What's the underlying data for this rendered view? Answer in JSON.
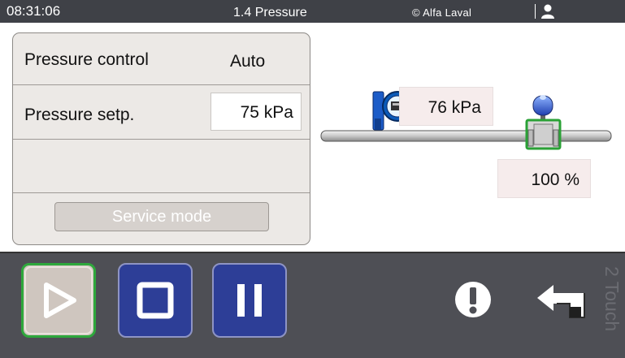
{
  "header": {
    "time": "08:31:06",
    "title": "1.4 Pressure",
    "brand": "© Alfa Laval",
    "user_icon": "user-icon"
  },
  "panel": {
    "rows": [
      {
        "label": "Pressure control",
        "value": "Auto"
      },
      {
        "label": "Pressure setp.",
        "value": "75 kPa"
      }
    ],
    "service_button": "Service mode"
  },
  "diagram": {
    "pressure_reading": "76 kPa",
    "valve_position": "100 %",
    "transmitter_icon": "pressure-transmitter-icon",
    "valve_icon": "control-valve-icon"
  },
  "commands": {
    "start_icon": "play-icon",
    "stop_icon": "stop-icon",
    "pause_icon": "pause-icon",
    "alarm_icon": "alarm-icon",
    "back_icon": "back-arrow-icon",
    "vertical_brand": "2 Touch"
  },
  "colors": {
    "header_bg": "#3f4147",
    "panel_bg": "#ece9e6",
    "command_bar_bg": "#4e4f55",
    "button_blue": "#2d3e97",
    "active_green": "#2ea83c"
  }
}
